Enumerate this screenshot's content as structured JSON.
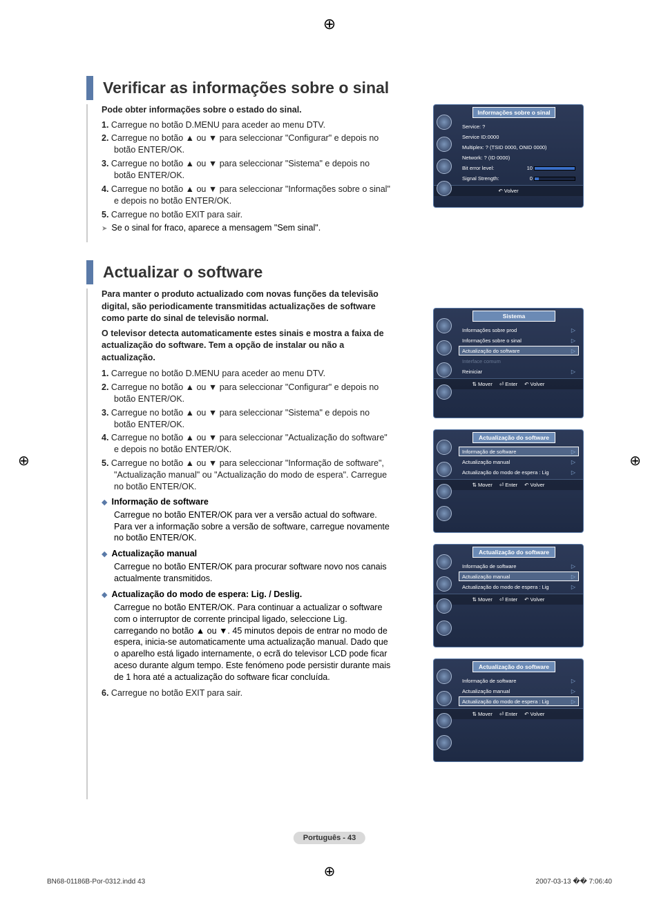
{
  "printmark_top": "⊕",
  "printmark_mid": "⊕",
  "side_marks": "⊕",
  "section1": {
    "title": "Verificar as informações sobre o sinal",
    "intro": "Pode obter informações sobre o estado do sinal.",
    "steps": [
      {
        "n": "1.",
        "t": "Carregue no botão D.MENU para aceder ao menu DTV."
      },
      {
        "n": "2.",
        "t": "Carregue no botão ▲ ou ▼ para seleccionar \"Configurar\" e depois no botão ENTER/OK."
      },
      {
        "n": "3.",
        "t": "Carregue no botão ▲ ou ▼ para seleccionar \"Sistema\" e depois no botão ENTER/OK."
      },
      {
        "n": "4.",
        "t": "Carregue no botão ▲ ou ▼ para seleccionar \"Informações sobre o sinal\" e depois no botão ENTER/OK."
      },
      {
        "n": "5.",
        "t": "Carregue no botão EXIT para sair."
      }
    ],
    "note": "Se o sinal for fraco, aparece a mensagem \"Sem sinal\"."
  },
  "section2": {
    "title": "Actualizar o software",
    "intro1": "Para manter o produto actualizado com novas funções da televisão digital, são periodicamente transmitidas actualizações de software como parte do sinal de televisão normal.",
    "intro2": "O televisor detecta automaticamente estes sinais e mostra a faixa de actualização do software. Tem a opção de instalar ou não a actualização.",
    "steps": [
      {
        "n": "1.",
        "t": "Carregue no botão D.MENU para aceder ao menu DTV."
      },
      {
        "n": "2.",
        "t": "Carregue no botão ▲ ou ▼ para seleccionar \"Configurar\" e depois no botão ENTER/OK."
      },
      {
        "n": "3.",
        "t": "Carregue no botão ▲ ou ▼ para seleccionar \"Sistema\" e depois no botão ENTER/OK."
      },
      {
        "n": "4.",
        "t": "Carregue no botão ▲ ou ▼ para seleccionar \"Actualização do software\" e depois no botão ENTER/OK."
      },
      {
        "n": "5.",
        "t": "Carregue no botão ▲ ou ▼ para seleccionar \"Informação de software\", \"Actualização manual\" ou \"Actualização do modo de espera\". Carregue no botão ENTER/OK."
      }
    ],
    "subs": [
      {
        "h": "Informação de software",
        "b": "Carregue no botão ENTER/OK para ver a versão actual do software. Para ver a informação sobre a versão de software, carregue novamente no botão ENTER/OK."
      },
      {
        "h": "Actualização manual",
        "b": "Carregue no botão ENTER/OK para procurar software novo nos canais actualmente transmitidos."
      },
      {
        "h": "Actualização do modo de espera: Lig. / Deslig.",
        "b": "Carregue no botão ENTER/OK. Para continuar a actualizar o software com o interruptor de corrente principal ligado, seleccione Lig. carregando no botão ▲ ou ▼. 45 minutos depois de entrar no modo de espera, inicia-se automaticamente uma actualização manual. Dado que o aparelho está ligado internamente, o ecrã do televisor LCD pode ficar aceso durante algum tempo. Este fenómeno pode persistir durante mais de 1 hora até a actualização do software ficar concluída."
      }
    ],
    "step6": {
      "n": "6.",
      "t": "Carregue no botão EXIT para sair."
    }
  },
  "osd1": {
    "title": "Informações sobre o sinal",
    "lines": [
      "Service: ?",
      "Service ID:0000",
      "Multiplex: ? (TSID 0000, ONID 0000)",
      "Network: ? (ID 0000)"
    ],
    "bit_label": "Bit error level:",
    "bit_val": "10",
    "sig_label": "Signal Strength:",
    "sig_val": "0",
    "footer_volver": "Volver"
  },
  "osd2": {
    "title": "Sistema",
    "items": [
      {
        "t": "Informações sobre prod",
        "sel": false
      },
      {
        "t": "Informações sobre o sinal",
        "sel": false
      },
      {
        "t": "Actualização do software",
        "sel": true
      },
      {
        "t": "Interface comum",
        "sel": false,
        "dis": true
      },
      {
        "t": "Reiniciar",
        "sel": false
      }
    ],
    "mover": "Mover",
    "enter": "Enter",
    "volver": "Volver"
  },
  "osd3": {
    "title": "Actualização do software",
    "items": [
      {
        "t": "Informação de software",
        "sel": true
      },
      {
        "t": "Actualização manual",
        "sel": false
      },
      {
        "t": "Actualização do modo de espera : Lig",
        "sel": false
      }
    ],
    "mover": "Mover",
    "enter": "Enter",
    "volver": "Volver"
  },
  "osd4": {
    "title": "Actualização do software",
    "items": [
      {
        "t": "Informação de software",
        "sel": false
      },
      {
        "t": "Actualização manual",
        "sel": true
      },
      {
        "t": "Actualização do modo de espera : Lig",
        "sel": false
      }
    ],
    "mover": "Mover",
    "enter": "Enter",
    "volver": "Volver"
  },
  "osd5": {
    "title": "Actualização do software",
    "items": [
      {
        "t": "Informação de software",
        "sel": false
      },
      {
        "t": "Actualização manual",
        "sel": false
      },
      {
        "t": "Actualização do modo de espera : Lig",
        "sel": true
      }
    ],
    "mover": "Mover",
    "enter": "Enter",
    "volver": "Volver"
  },
  "page_footer": "Português - 43",
  "doc_footer_left": "BN68-01186B-Por-0312.indd   43",
  "doc_footer_right": "2007-03-13   �� 7:06:40"
}
